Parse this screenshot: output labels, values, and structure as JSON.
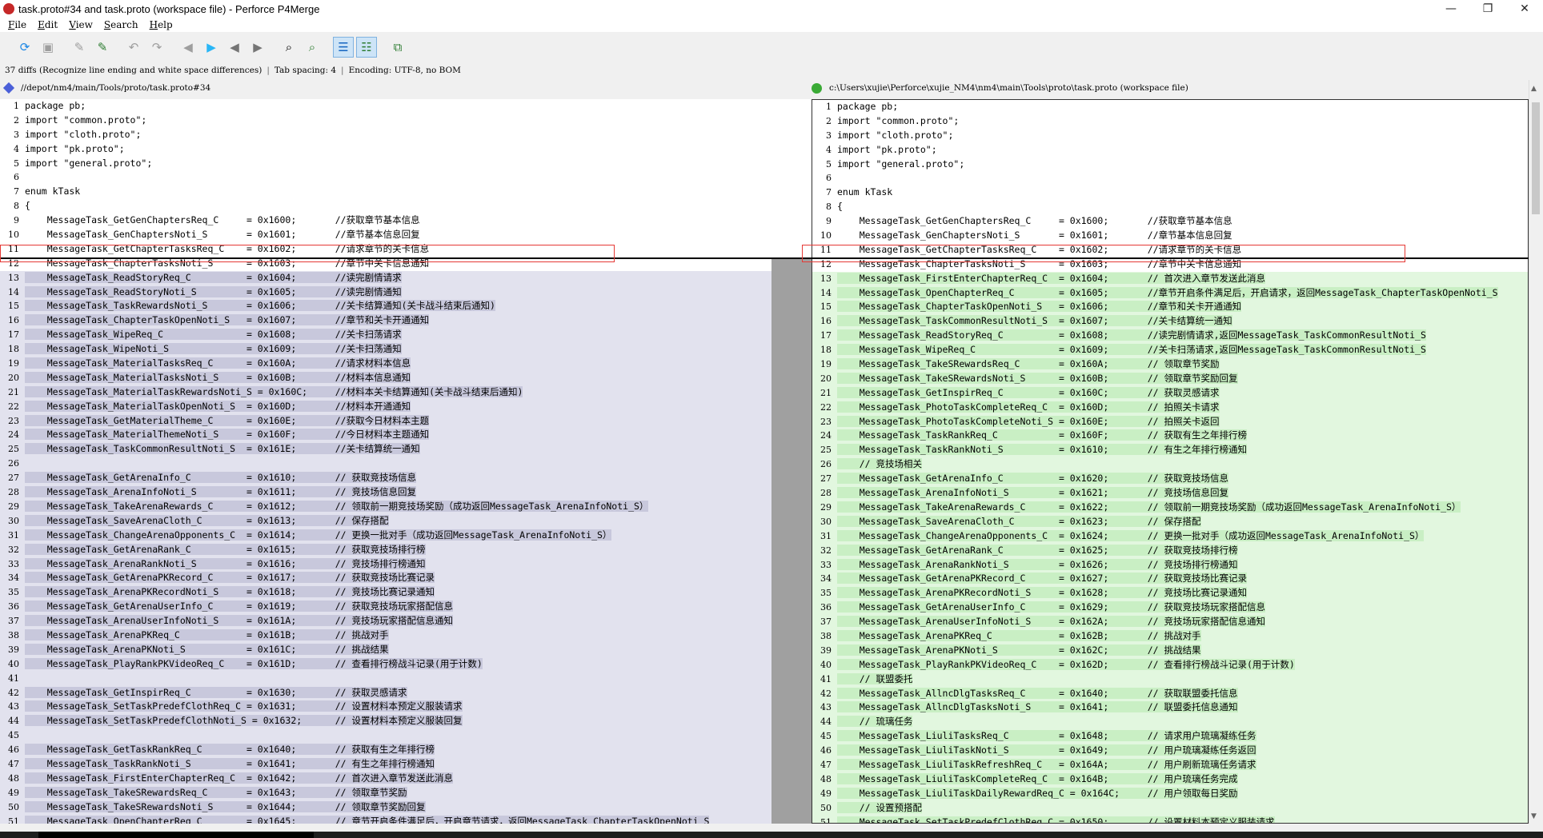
{
  "window": {
    "title": "task.proto#34 and task.proto (workspace file) - Perforce P4Merge",
    "minimize": "—",
    "maximize": "❐",
    "close": "✕"
  },
  "menu": [
    {
      "u": "F",
      "rest": "ile"
    },
    {
      "u": "E",
      "rest": "dit"
    },
    {
      "u": "V",
      "rest": "iew"
    },
    {
      "u": "S",
      "rest": "earch"
    },
    {
      "u": "H",
      "rest": "elp"
    }
  ],
  "toolbar": {
    "icons": [
      {
        "name": "refresh-icon",
        "glyph": "⟳",
        "color": "#1e88e5"
      },
      {
        "name": "save-icon",
        "glyph": "▣",
        "color": "#9e9e9e"
      },
      {
        "name": "edit-gray-icon",
        "glyph": "✎",
        "color": "#9e9e9e"
      },
      {
        "name": "edit-green-icon",
        "glyph": "✎",
        "color": "#2e7d32"
      },
      {
        "name": "undo-icon",
        "glyph": "↶",
        "color": "#9e9e9e"
      },
      {
        "name": "redo-icon",
        "glyph": "↷",
        "color": "#9e9e9e"
      },
      {
        "name": "prev-diff-icon",
        "glyph": "◀",
        "color": "#9e9e9e"
      },
      {
        "name": "next-diff-icon",
        "glyph": "▶",
        "color": "#29b6f6"
      },
      {
        "name": "prev-change-icon",
        "glyph": "◀",
        "color": "#757575"
      },
      {
        "name": "next-change-icon",
        "glyph": "▶",
        "color": "#757575"
      },
      {
        "name": "find-icon",
        "glyph": "⌕",
        "color": "#000000"
      },
      {
        "name": "find-next-icon",
        "glyph": "⌕",
        "color": "#2e7d32"
      },
      {
        "name": "line-numbers-icon",
        "glyph": "☰",
        "color": "#1565c0"
      },
      {
        "name": "diff-layout-icon",
        "glyph": "☷",
        "color": "#2e7d32"
      },
      {
        "name": "compare-options-icon",
        "glyph": "⧉",
        "color": "#2e7d32"
      }
    ]
  },
  "status": {
    "diffs": "37 diffs (Recognize line ending and white space differences)",
    "tab": "Tab spacing: 4",
    "encoding": "Encoding: UTF-8, no BOM"
  },
  "left_file": {
    "path": "//depot/nm4/main/Tools/proto/task.proto#34",
    "color": "#4a5fd8"
  },
  "right_file": {
    "path": "c:\\Users\\xujie\\Perforce\\xujie_NM4\\nm4\\main\\Tools\\proto\\task.proto (workspace file)",
    "color": "#3aaa35"
  },
  "left_lines": [
    {
      "n": "1",
      "t": "package pb;",
      "c": 0
    },
    {
      "n": "2",
      "t": "import \"common.proto\";",
      "c": 0
    },
    {
      "n": "3",
      "t": "import \"cloth.proto\";",
      "c": 0
    },
    {
      "n": "4",
      "t": "import \"pk.proto\";",
      "c": 0
    },
    {
      "n": "5",
      "t": "import \"general.proto\";",
      "c": 0
    },
    {
      "n": "6",
      "t": "",
      "c": 0
    },
    {
      "n": "7",
      "t": "enum kTask",
      "c": 0
    },
    {
      "n": "8",
      "t": "{",
      "c": 0
    },
    {
      "n": "9",
      "t": "    MessageTask_GetGenChaptersReq_C     = 0x1600;       //获取章节基本信息",
      "c": 0
    },
    {
      "n": "10",
      "t": "    MessageTask_GenChaptersNoti_S       = 0x1601;       //章节基本信息回复",
      "c": 0
    },
    {
      "n": "11",
      "t": "    MessageTask_GetChapterTasksReq_C    = 0x1602;       //请求章节的关卡信息",
      "c": 0
    },
    {
      "n": "12",
      "t": "    MessageTask_ChapterTasksNoti_S      = 0x1603;       //章节中关卡信息通知",
      "c": 0
    },
    {
      "n": "13",
      "t": "    MessageTask_ReadStoryReq_C          = 0x1604;       //读完剧情请求",
      "c": 1
    },
    {
      "n": "14",
      "t": "    MessageTask_ReadStoryNoti_S         = 0x1605;       //读完剧情通知",
      "c": 1
    },
    {
      "n": "15",
      "t": "    MessageTask_TaskRewardsNoti_S       = 0x1606;       //关卡结算通知(关卡战斗结束后通知)",
      "c": 1
    },
    {
      "n": "16",
      "t": "    MessageTask_ChapterTaskOpenNoti_S   = 0x1607;       //章节和关卡开通通知",
      "c": 1
    },
    {
      "n": "17",
      "t": "    MessageTask_WipeReq_C               = 0x1608;       //关卡扫荡请求",
      "c": 1
    },
    {
      "n": "18",
      "t": "    MessageTask_WipeNoti_S              = 0x1609;       //关卡扫荡通知",
      "c": 1
    },
    {
      "n": "19",
      "t": "    MessageTask_MaterialTasksReq_C      = 0x160A;       //请求材料本信息",
      "c": 1
    },
    {
      "n": "20",
      "t": "    MessageTask_MaterialTasksNoti_S     = 0x160B;       //材料本信息通知",
      "c": 1
    },
    {
      "n": "21",
      "t": "    MessageTask_MaterialTaskRewardsNoti_S = 0x160C;     //材料本关卡结算通知(关卡战斗结束后通知)",
      "c": 1
    },
    {
      "n": "22",
      "t": "    MessageTask_MaterialTaskOpenNoti_S  = 0x160D;       //材料本开通通知",
      "c": 1
    },
    {
      "n": "23",
      "t": "    MessageTask_GetMaterialTheme_C      = 0x160E;       //获取今日材料本主题",
      "c": 1
    },
    {
      "n": "24",
      "t": "    MessageTask_MaterialThemeNoti_S     = 0x160F;       //今日材料本主题通知",
      "c": 1
    },
    {
      "n": "25",
      "t": "    MessageTask_TaskCommonResultNoti_S  = 0x161E;       //关卡结算统一通知",
      "c": 1
    },
    {
      "n": "26",
      "t": "",
      "c": 1
    },
    {
      "n": "27",
      "t": "    MessageTask_GetArenaInfo_C          = 0x1610;       // 获取竞技场信息",
      "c": 1
    },
    {
      "n": "28",
      "t": "    MessageTask_ArenaInfoNoti_S         = 0x1611;       // 竞技场信息回复",
      "c": 1
    },
    {
      "n": "29",
      "t": "    MessageTask_TakeArenaRewards_C      = 0x1612;       // 领取前一期竞技场奖励（成功返回MessageTask_ArenaInfoNoti_S）",
      "c": 1
    },
    {
      "n": "30",
      "t": "    MessageTask_SaveArenaCloth_C        = 0x1613;       // 保存搭配",
      "c": 1
    },
    {
      "n": "31",
      "t": "    MessageTask_ChangeArenaOpponents_C  = 0x1614;       // 更换一批对手（成功返回MessageTask_ArenaInfoNoti_S）",
      "c": 1
    },
    {
      "n": "32",
      "t": "    MessageTask_GetArenaRank_C          = 0x1615;       // 获取竞技场排行榜",
      "c": 1
    },
    {
      "n": "33",
      "t": "    MessageTask_ArenaRankNoti_S         = 0x1616;       // 竞技场排行榜通知",
      "c": 1
    },
    {
      "n": "34",
      "t": "    MessageTask_GetArenaPKRecord_C      = 0x1617;       // 获取竞技场比赛记录",
      "c": 1
    },
    {
      "n": "35",
      "t": "    MessageTask_ArenaPKRecordNoti_S     = 0x1618;       // 竞技场比赛记录通知",
      "c": 1
    },
    {
      "n": "36",
      "t": "    MessageTask_GetArenaUserInfo_C      = 0x1619;       // 获取竞技场玩家搭配信息",
      "c": 1
    },
    {
      "n": "37",
      "t": "    MessageTask_ArenaUserInfoNoti_S     = 0x161A;       // 竞技场玩家搭配信息通知",
      "c": 1
    },
    {
      "n": "38",
      "t": "    MessageTask_ArenaPKReq_C            = 0x161B;       // 挑战对手",
      "c": 1
    },
    {
      "n": "39",
      "t": "    MessageTask_ArenaPKNoti_S           = 0x161C;       // 挑战结果",
      "c": 1
    },
    {
      "n": "40",
      "t": "    MessageTask_PlayRankPKVideoReq_C    = 0x161D;       // 查看排行榜战斗记录(用于计数)",
      "c": 1
    },
    {
      "n": "41",
      "t": "",
      "c": 1
    },
    {
      "n": "42",
      "t": "    MessageTask_GetInspirReq_C          = 0x1630;       // 获取灵感请求",
      "c": 1
    },
    {
      "n": "43",
      "t": "    MessageTask_SetTaskPredefClothReq_C = 0x1631;       // 设置材料本预定义服装请求",
      "c": 1
    },
    {
      "n": "44",
      "t": "    MessageTask_SetTaskPredefClothNoti_S = 0x1632;      // 设置材料本预定义服装回复",
      "c": 1
    },
    {
      "n": "45",
      "t": "",
      "c": 1
    },
    {
      "n": "46",
      "t": "    MessageTask_GetTaskRankReq_C        = 0x1640;       // 获取有生之年排行榜",
      "c": 1
    },
    {
      "n": "47",
      "t": "    MessageTask_TaskRankNoti_S          = 0x1641;       // 有生之年排行榜通知",
      "c": 1
    },
    {
      "n": "48",
      "t": "    MessageTask_FirstEnterChapterReq_C  = 0x1642;       // 首次进入章节发送此消息",
      "c": 1
    },
    {
      "n": "49",
      "t": "    MessageTask_TakeSRewardsReq_C       = 0x1643;       // 领取章节奖励",
      "c": 1
    },
    {
      "n": "50",
      "t": "    MessageTask_TakeSRewardsNoti_S      = 0x1644;       // 领取章节奖励回复",
      "c": 1
    },
    {
      "n": "51",
      "t": "    MessageTask_OpenChapterReq_C        = 0x1645;       // 章节开启条件满足后，开启章节请求，返回MessageTask_ChapterTaskOpenNoti_S",
      "c": 1
    }
  ],
  "right_lines": [
    {
      "n": "1",
      "t": "package pb;",
      "c": 0
    },
    {
      "n": "2",
      "t": "import \"common.proto\";",
      "c": 0
    },
    {
      "n": "3",
      "t": "import \"cloth.proto\";",
      "c": 0
    },
    {
      "n": "4",
      "t": "import \"pk.proto\";",
      "c": 0
    },
    {
      "n": "5",
      "t": "import \"general.proto\";",
      "c": 0
    },
    {
      "n": "6",
      "t": "",
      "c": 0
    },
    {
      "n": "7",
      "t": "enum kTask",
      "c": 0
    },
    {
      "n": "8",
      "t": "{",
      "c": 0
    },
    {
      "n": "9",
      "t": "    MessageTask_GetGenChaptersReq_C     = 0x1600;       //获取章节基本信息",
      "c": 0
    },
    {
      "n": "10",
      "t": "    MessageTask_GenChaptersNoti_S       = 0x1601;       //章节基本信息回复",
      "c": 0
    },
    {
      "n": "11",
      "t": "    MessageTask_GetChapterTasksReq_C    = 0x1602;       //请求章节的关卡信息",
      "c": 0
    },
    {
      "n": "12",
      "t": "    MessageTask_ChapterTasksNoti_S      = 0x1603;       //章节中关卡信息通知",
      "c": 0
    },
    {
      "n": "13",
      "t": "    MessageTask_FirstEnterChapterReq_C  = 0x1604;       // 首次进入章节发送此消息",
      "c": 1
    },
    {
      "n": "14",
      "t": "    MessageTask_OpenChapterReq_C        = 0x1605;       //章节开启条件满足后，开启请求，返回MessageTask_ChapterTaskOpenNoti_S",
      "c": 1
    },
    {
      "n": "15",
      "t": "    MessageTask_ChapterTaskOpenNoti_S   = 0x1606;       //章节和关卡开通通知",
      "c": 1
    },
    {
      "n": "16",
      "t": "    MessageTask_TaskCommonResultNoti_S  = 0x1607;       //关卡结算统一通知",
      "c": 1
    },
    {
      "n": "17",
      "t": "    MessageTask_ReadStoryReq_C          = 0x1608;       //读完剧情请求,返回MessageTask_TaskCommonResultNoti_S",
      "c": 1
    },
    {
      "n": "18",
      "t": "    MessageTask_WipeReq_C               = 0x1609;       //关卡扫荡请求,返回MessageTask_TaskCommonResultNoti_S",
      "c": 1
    },
    {
      "n": "19",
      "t": "    MessageTask_TakeSRewardsReq_C       = 0x160A;       // 领取章节奖励",
      "c": 1
    },
    {
      "n": "20",
      "t": "    MessageTask_TakeSRewardsNoti_S      = 0x160B;       // 领取章节奖励回复",
      "c": 1
    },
    {
      "n": "21",
      "t": "    MessageTask_GetInspirReq_C          = 0x160C;       // 获取灵感请求",
      "c": 1
    },
    {
      "n": "22",
      "t": "    MessageTask_PhotoTaskCompleteReq_C  = 0x160D;       // 拍照关卡请求",
      "c": 1
    },
    {
      "n": "23",
      "t": "    MessageTask_PhotoTaskCompleteNoti_S = 0x160E;       // 拍照关卡返回",
      "c": 1
    },
    {
      "n": "24",
      "t": "    MessageTask_TaskRankReq_C           = 0x160F;       // 获取有生之年排行榜",
      "c": 1
    },
    {
      "n": "25",
      "t": "    MessageTask_TaskRankNoti_S          = 0x1610;       // 有生之年排行榜通知",
      "c": 1
    },
    {
      "n": "26",
      "t": "    // 竞技场相关",
      "c": 1
    },
    {
      "n": "27",
      "t": "    MessageTask_GetArenaInfo_C          = 0x1620;       // 获取竞技场信息",
      "c": 1
    },
    {
      "n": "28",
      "t": "    MessageTask_ArenaInfoNoti_S         = 0x1621;       // 竞技场信息回复",
      "c": 1
    },
    {
      "n": "29",
      "t": "    MessageTask_TakeArenaRewards_C      = 0x1622;       // 领取前一期竞技场奖励（成功返回MessageTask_ArenaInfoNoti_S）",
      "c": 1
    },
    {
      "n": "30",
      "t": "    MessageTask_SaveArenaCloth_C        = 0x1623;       // 保存搭配",
      "c": 1
    },
    {
      "n": "31",
      "t": "    MessageTask_ChangeArenaOpponents_C  = 0x1624;       // 更换一批对手（成功返回MessageTask_ArenaInfoNoti_S）",
      "c": 1
    },
    {
      "n": "32",
      "t": "    MessageTask_GetArenaRank_C          = 0x1625;       // 获取竞技场排行榜",
      "c": 1
    },
    {
      "n": "33",
      "t": "    MessageTask_ArenaRankNoti_S         = 0x1626;       // 竞技场排行榜通知",
      "c": 1
    },
    {
      "n": "34",
      "t": "    MessageTask_GetArenaPKRecord_C      = 0x1627;       // 获取竞技场比赛记录",
      "c": 1
    },
    {
      "n": "35",
      "t": "    MessageTask_ArenaPKRecordNoti_S     = 0x1628;       // 竞技场比赛记录通知",
      "c": 1
    },
    {
      "n": "36",
      "t": "    MessageTask_GetArenaUserInfo_C      = 0x1629;       // 获取竞技场玩家搭配信息",
      "c": 1
    },
    {
      "n": "37",
      "t": "    MessageTask_ArenaUserInfoNoti_S     = 0x162A;       // 竞技场玩家搭配信息通知",
      "c": 1
    },
    {
      "n": "38",
      "t": "    MessageTask_ArenaPKReq_C            = 0x162B;       // 挑战对手",
      "c": 1
    },
    {
      "n": "39",
      "t": "    MessageTask_ArenaPKNoti_S           = 0x162C;       // 挑战结果",
      "c": 1
    },
    {
      "n": "40",
      "t": "    MessageTask_PlayRankPKVideoReq_C    = 0x162D;       // 查看排行榜战斗记录(用于计数)",
      "c": 1
    },
    {
      "n": "41",
      "t": "    // 联盟委托",
      "c": 1
    },
    {
      "n": "42",
      "t": "    MessageTask_AllncDlgTasksReq_C      = 0x1640;       // 获取联盟委托信息",
      "c": 1
    },
    {
      "n": "43",
      "t": "    MessageTask_AllncDlgTasksNoti_S     = 0x1641;       // 联盟委托信息通知",
      "c": 1
    },
    {
      "n": "44",
      "t": "    // 琉璃任务",
      "c": 1
    },
    {
      "n": "45",
      "t": "    MessageTask_LiuliTasksReq_C         = 0x1648;       // 请求用户琉璃凝练任务",
      "c": 1
    },
    {
      "n": "46",
      "t": "    MessageTask_LiuliTaskNoti_S         = 0x1649;       // 用户琉璃凝练任务返回",
      "c": 1
    },
    {
      "n": "47",
      "t": "    MessageTask_LiuliTaskRefreshReq_C   = 0x164A;       // 用户刷新琉璃任务请求",
      "c": 1
    },
    {
      "n": "48",
      "t": "    MessageTask_LiuliTaskCompleteReq_C  = 0x164B;       // 用户琉璃任务完成",
      "c": 1
    },
    {
      "n": "49",
      "t": "    MessageTask_LiuliTaskDailyRewardReq_C = 0x164C;     // 用户领取每日奖励",
      "c": 1
    },
    {
      "n": "50",
      "t": "    // 设置预搭配",
      "c": 1
    },
    {
      "n": "51",
      "t": "    MessageTask_SetTaskPredefClothReq_C = 0x1650;       // 设置材料本预定义服装请求",
      "c": 1
    }
  ]
}
